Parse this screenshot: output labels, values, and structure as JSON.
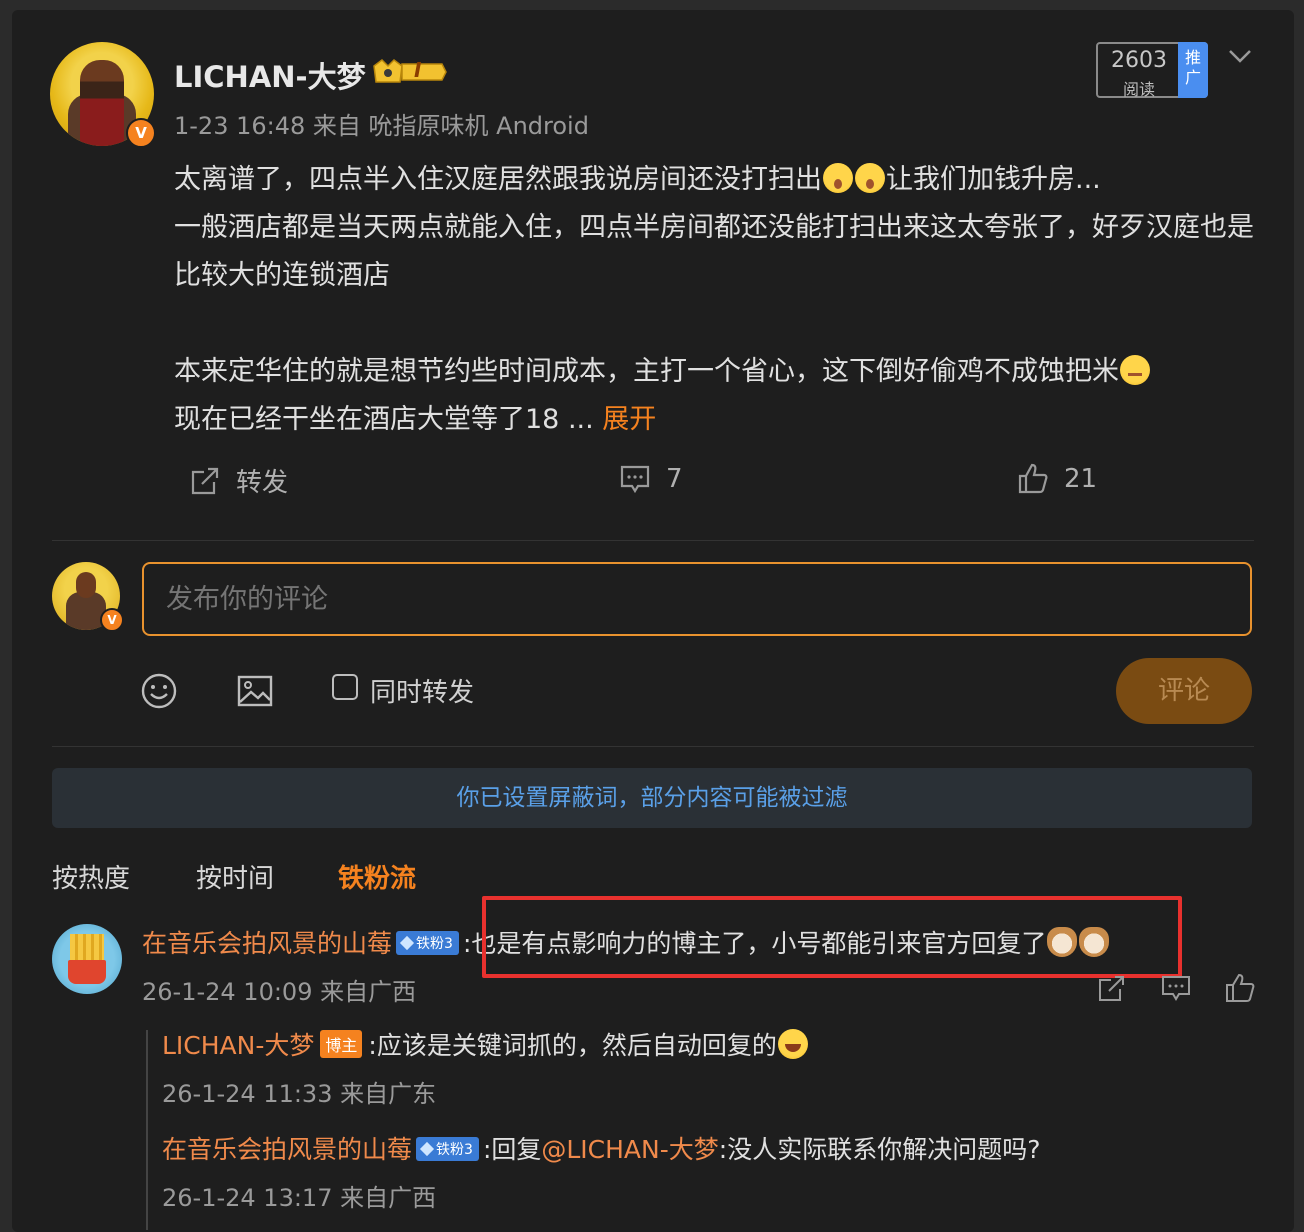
{
  "post": {
    "username": "LICHAN-大梦",
    "level_badge": "I",
    "verified_mark": "V",
    "meta": "1-23 16:48  来自  吮指原味机 Android",
    "reads_count": "2603",
    "reads_label": "阅读",
    "promo_label": "推广",
    "line1": "太离谱了，四点半入住汉庭居然跟我说房间还没打扫出",
    "line1_tail": "让我们加钱升房...",
    "line2": "一般酒店都是当天两点就能入住，四点半房间都还没能打扫出来这太夸张了，好歹汉庭也是比较大的连锁酒店",
    "line3": "本来定华住的就是想节约些时间成本，主打一个省心，这下倒好偷鸡不成蚀把米",
    "line4": "现在已经干坐在酒店大堂等了18 ",
    "ellipsis": "... ",
    "expand_label": "展开",
    "repost_label": "转发",
    "comment_count": "7",
    "like_count": "21"
  },
  "composer": {
    "placeholder": "发布你的评论",
    "also_repost_label": "同时转发",
    "submit_label": "评论"
  },
  "notice": "你已设置屏蔽词，部分内容可能被过滤",
  "sort_tabs": [
    "按热度",
    "按时间",
    "铁粉流"
  ],
  "comments": [
    {
      "name": "在音乐会拍风景的山莓",
      "badge": "铁粉3",
      "text": ":也是有点影响力的博主了，小号都能引来官方回复了",
      "meta": "26-1-24 10:09 来自广西"
    }
  ],
  "replies": [
    {
      "name": "LICHAN-大梦",
      "badge": "博主",
      "text": ":应该是关键词抓的，然后自动回复的",
      "meta": "26-1-24 11:33 来自广东"
    },
    {
      "name": "在音乐会拍风景的山莓",
      "badge": "铁粉3",
      "text_prefix": ":回复",
      "mention": "@LICHAN-大梦",
      "text": ":没人实际联系你解决问题吗?",
      "meta": "26-1-24 13:17 来自广西"
    }
  ],
  "colors": {
    "accent": "#f5821f",
    "link_blue": "#5aa0e8",
    "highlight_red": "#e8312e"
  }
}
